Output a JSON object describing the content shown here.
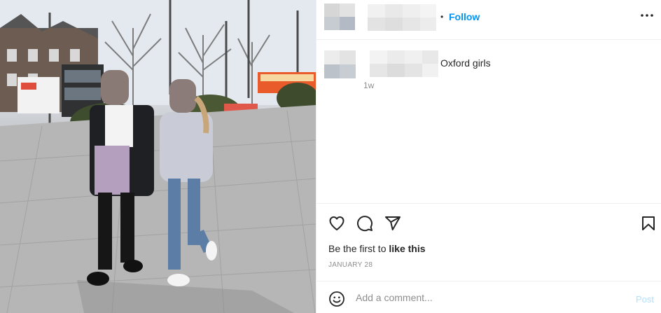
{
  "post": {
    "caption": "Oxford girls",
    "caption_time": "1w",
    "follow_label": "Follow",
    "separator": "•",
    "likes_prefix": "Be the first to ",
    "likes_action": "like this",
    "date": "JANUARY 28"
  },
  "comment": {
    "placeholder": "Add a comment...",
    "post_label": "Post"
  },
  "icons": {
    "more": "more-options-icon",
    "like": "heart-icon",
    "comment": "comment-icon",
    "share": "share-icon",
    "save": "bookmark-icon",
    "emoji": "emoji-icon"
  },
  "colors": {
    "accent": "#0095f6",
    "post_disabled": "#b2dffc",
    "muted": "#8e8e8e",
    "text": "#262626"
  }
}
